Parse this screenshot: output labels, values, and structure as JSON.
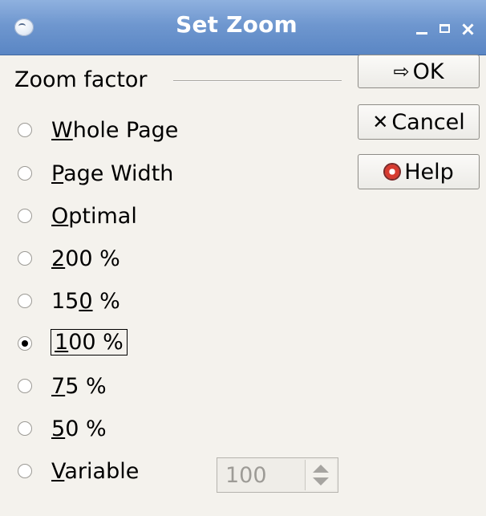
{
  "window": {
    "title": "Set Zoom"
  },
  "zoom_group": {
    "label": "Zoom factor"
  },
  "options": [
    {
      "label": "Whole Page",
      "checked": false
    },
    {
      "label": "Page Width",
      "checked": false
    },
    {
      "label": "Optimal",
      "checked": false
    },
    {
      "label": "200 %",
      "checked": false
    },
    {
      "label": "150 %",
      "checked": false
    },
    {
      "label": "100 %",
      "checked": true
    },
    {
      "label": "75 %",
      "checked": false
    },
    {
      "label": "50 %",
      "checked": false
    },
    {
      "label": "Variable",
      "checked": false
    }
  ],
  "variable": {
    "value": "100"
  },
  "buttons": {
    "ok": "OK",
    "cancel": "Cancel",
    "help": "Help"
  },
  "icons": {
    "ok": "arrow-right-icon",
    "cancel": "x-icon",
    "help": "lifebuoy-icon"
  }
}
